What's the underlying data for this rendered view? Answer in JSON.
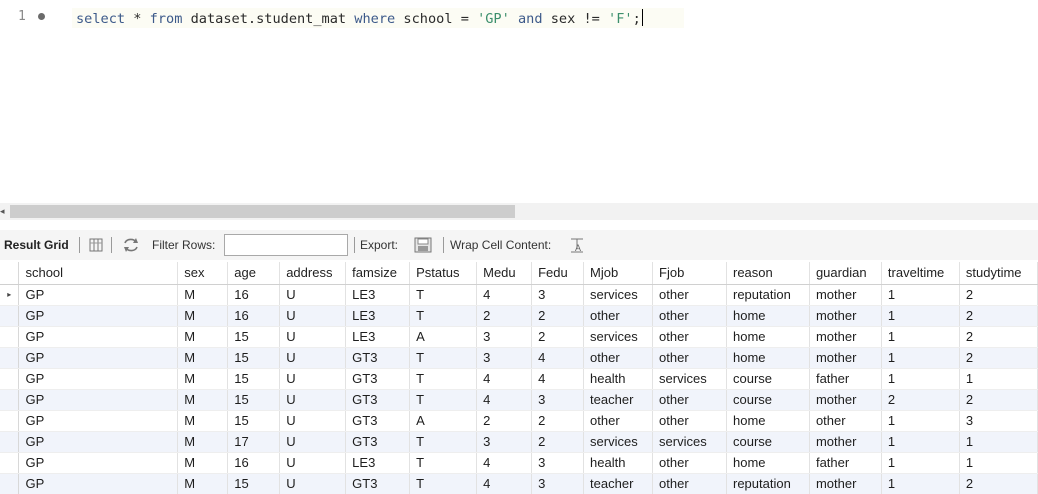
{
  "editor": {
    "line_number": "1",
    "query_tokens": [
      {
        "text": "select",
        "kind": "kw"
      },
      {
        "text": " * ",
        "kind": "op"
      },
      {
        "text": "from",
        "kind": "kw"
      },
      {
        "text": " dataset.student_mat ",
        "kind": "id"
      },
      {
        "text": "where",
        "kind": "kw"
      },
      {
        "text": " school = ",
        "kind": "id"
      },
      {
        "text": "'GP'",
        "kind": "str"
      },
      {
        "text": " ",
        "kind": "op"
      },
      {
        "text": "and",
        "kind": "kw"
      },
      {
        "text": " sex != ",
        "kind": "id"
      },
      {
        "text": "'F'",
        "kind": "str"
      },
      {
        "text": ";",
        "kind": "op"
      }
    ]
  },
  "toolbar": {
    "result_grid_label": "Result Grid",
    "filter_rows_label": "Filter Rows:",
    "filter_value": "",
    "export_label": "Export:",
    "wrap_label": "Wrap Cell Content:"
  },
  "grid": {
    "columns": [
      "school",
      "sex",
      "age",
      "address",
      "famsize",
      "Pstatus",
      "Medu",
      "Fedu",
      "Mjob",
      "Fjob",
      "reason",
      "guardian",
      "traveltime",
      "studytime"
    ],
    "rows": [
      [
        "GP",
        "M",
        "16",
        "U",
        "LE3",
        "T",
        "4",
        "3",
        "services",
        "other",
        "reputation",
        "mother",
        "1",
        "2"
      ],
      [
        "GP",
        "M",
        "16",
        "U",
        "LE3",
        "T",
        "2",
        "2",
        "other",
        "other",
        "home",
        "mother",
        "1",
        "2"
      ],
      [
        "GP",
        "M",
        "15",
        "U",
        "LE3",
        "A",
        "3",
        "2",
        "services",
        "other",
        "home",
        "mother",
        "1",
        "2"
      ],
      [
        "GP",
        "M",
        "15",
        "U",
        "GT3",
        "T",
        "3",
        "4",
        "other",
        "other",
        "home",
        "mother",
        "1",
        "2"
      ],
      [
        "GP",
        "M",
        "15",
        "U",
        "GT3",
        "T",
        "4",
        "4",
        "health",
        "services",
        "course",
        "father",
        "1",
        "1"
      ],
      [
        "GP",
        "M",
        "15",
        "U",
        "GT3",
        "T",
        "4",
        "3",
        "teacher",
        "other",
        "course",
        "mother",
        "2",
        "2"
      ],
      [
        "GP",
        "M",
        "15",
        "U",
        "GT3",
        "A",
        "2",
        "2",
        "other",
        "other",
        "home",
        "other",
        "1",
        "3"
      ],
      [
        "GP",
        "M",
        "17",
        "U",
        "GT3",
        "T",
        "3",
        "2",
        "services",
        "services",
        "course",
        "mother",
        "1",
        "1"
      ],
      [
        "GP",
        "M",
        "16",
        "U",
        "LE3",
        "T",
        "4",
        "3",
        "health",
        "other",
        "home",
        "father",
        "1",
        "1"
      ],
      [
        "GP",
        "M",
        "15",
        "U",
        "GT3",
        "T",
        "4",
        "3",
        "teacher",
        "other",
        "reputation",
        "mother",
        "1",
        "2"
      ]
    ],
    "current_row_marker": "▸"
  }
}
